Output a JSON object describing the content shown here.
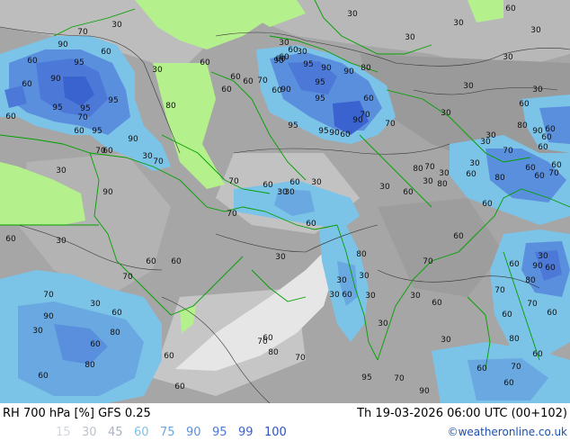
{
  "footer": {
    "title": "RH 700 hPa [%] GFS 0.25",
    "valid": "Th 19-03-2026 06:00 UTC (00+102)",
    "credit": "©weatheronline.co.uk"
  },
  "legend": [
    {
      "label": "15",
      "color": "#d4d8de"
    },
    {
      "label": "30",
      "color": "#bcc4cc"
    },
    {
      "label": "45",
      "color": "#a9b4bf"
    },
    {
      "label": "60",
      "color": "#7cc3e8"
    },
    {
      "label": "75",
      "color": "#69a8e0"
    },
    {
      "label": "90",
      "color": "#5a8fde"
    },
    {
      "label": "95",
      "color": "#4c78d8"
    },
    {
      "label": "99",
      "color": "#3b63cf"
    },
    {
      "label": "100",
      "color": "#2e50c5"
    }
  ],
  "colors": {
    "background_gray": "#a6a6a6",
    "dry_green": "#b4f08c",
    "dry_white": "#e8e8e8",
    "borders": "#00a000",
    "contours": "#333333"
  },
  "contour_labels": [
    {
      "v": "30"
    },
    {
      "v": "60"
    },
    {
      "v": "30"
    },
    {
      "v": "30"
    },
    {
      "v": "30"
    },
    {
      "v": "30"
    },
    {
      "v": "90"
    },
    {
      "v": "70"
    },
    {
      "v": "60"
    },
    {
      "v": "60"
    },
    {
      "v": "95"
    },
    {
      "v": "90"
    },
    {
      "v": "60"
    },
    {
      "v": "30"
    },
    {
      "v": "30"
    },
    {
      "v": "60"
    },
    {
      "v": "95"
    },
    {
      "v": "60"
    },
    {
      "v": "70"
    },
    {
      "v": "60"
    },
    {
      "v": "95"
    },
    {
      "v": "90"
    },
    {
      "v": "80"
    },
    {
      "v": "60"
    },
    {
      "v": "90"
    },
    {
      "v": "60"
    },
    {
      "v": "95"
    },
    {
      "v": "70"
    },
    {
      "v": "90"
    },
    {
      "v": "95"
    },
    {
      "v": "30"
    },
    {
      "v": "60"
    },
    {
      "v": "90"
    },
    {
      "v": "60"
    },
    {
      "v": "80"
    },
    {
      "v": "95"
    },
    {
      "v": "95"
    },
    {
      "v": "95"
    },
    {
      "v": "90"
    },
    {
      "v": "60"
    },
    {
      "v": "70"
    },
    {
      "v": "60"
    },
    {
      "v": "95"
    },
    {
      "v": "60"
    },
    {
      "v": "70"
    },
    {
      "v": "30"
    },
    {
      "v": "70"
    },
    {
      "v": "30"
    },
    {
      "v": "60"
    },
    {
      "v": "90"
    },
    {
      "v": "60"
    },
    {
      "v": "30"
    },
    {
      "v": "30"
    },
    {
      "v": "60"
    },
    {
      "v": "90"
    },
    {
      "v": "80"
    },
    {
      "v": "60"
    },
    {
      "v": "30"
    },
    {
      "v": "30"
    },
    {
      "v": "95"
    },
    {
      "v": "90"
    },
    {
      "v": "60"
    },
    {
      "v": "70"
    },
    {
      "v": "80"
    },
    {
      "v": "70"
    },
    {
      "v": "60"
    },
    {
      "v": "60"
    },
    {
      "v": "30"
    },
    {
      "v": "30"
    },
    {
      "v": "70"
    },
    {
      "v": "60"
    },
    {
      "v": "60"
    },
    {
      "v": "30"
    },
    {
      "v": "80"
    },
    {
      "v": "30"
    },
    {
      "v": "30"
    },
    {
      "v": "80"
    },
    {
      "v": "70"
    },
    {
      "v": "60"
    },
    {
      "v": "60"
    },
    {
      "v": "60"
    },
    {
      "v": "30"
    },
    {
      "v": "60"
    },
    {
      "v": "90"
    },
    {
      "v": "70"
    },
    {
      "v": "60"
    },
    {
      "v": "30"
    },
    {
      "v": "30"
    },
    {
      "v": "70"
    },
    {
      "v": "60"
    },
    {
      "v": "30"
    },
    {
      "v": "60"
    },
    {
      "v": "60"
    },
    {
      "v": "30"
    },
    {
      "v": "60"
    },
    {
      "v": "60"
    },
    {
      "v": "60"
    },
    {
      "v": "30"
    },
    {
      "v": "80"
    },
    {
      "v": "70"
    },
    {
      "v": "30"
    },
    {
      "v": "30"
    },
    {
      "v": "30"
    },
    {
      "v": "60"
    },
    {
      "v": "30"
    },
    {
      "v": "30"
    },
    {
      "v": "30"
    },
    {
      "v": "60"
    },
    {
      "v": "70"
    },
    {
      "v": "60"
    },
    {
      "v": "30"
    },
    {
      "v": "60"
    },
    {
      "v": "90"
    },
    {
      "v": "70"
    },
    {
      "v": "80"
    },
    {
      "v": "60"
    },
    {
      "v": "70"
    },
    {
      "v": "60"
    },
    {
      "v": "30"
    },
    {
      "v": "80"
    },
    {
      "v": "60"
    },
    {
      "v": "70"
    },
    {
      "v": "60"
    },
    {
      "v": "60"
    },
    {
      "v": "70"
    },
    {
      "v": "90"
    },
    {
      "v": "95"
    },
    {
      "v": "60"
    },
    {
      "v": "60"
    },
    {
      "v": "70"
    },
    {
      "v": "30"
    },
    {
      "v": "60"
    },
    {
      "v": "90"
    },
    {
      "v": "30"
    },
    {
      "v": "60"
    },
    {
      "v": "80"
    },
    {
      "v": "60"
    },
    {
      "v": "80"
    },
    {
      "v": "80"
    },
    {
      "v": "70"
    },
    {
      "v": "70"
    },
    {
      "v": "60"
    }
  ]
}
